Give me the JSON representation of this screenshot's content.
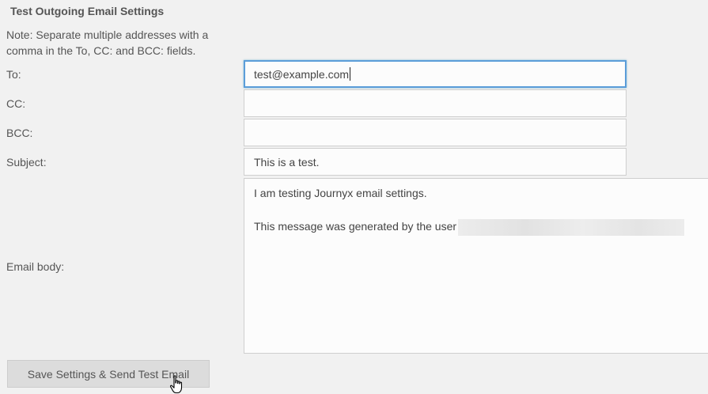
{
  "section": {
    "title": "Test Outgoing Email Settings",
    "note": "Note: Separate multiple addresses with a comma in the To, CC: and BCC: fields."
  },
  "fields": {
    "to": {
      "label": "To:",
      "value": "test@example.com"
    },
    "cc": {
      "label": "CC:",
      "value": ""
    },
    "bcc": {
      "label": "BCC:",
      "value": ""
    },
    "subject": {
      "label": "Subject:",
      "value": "This is a test."
    },
    "body": {
      "label": "Email body:",
      "line1": "I am testing Journyx email settings.",
      "line2": "This message was generated by the user"
    }
  },
  "actions": {
    "submit_label": "Save Settings & Send Test Email"
  },
  "icons": {
    "cursor": "hand-pointer-icon"
  },
  "colors": {
    "background": "#f1f1f1",
    "focus_border": "#5b9dd9",
    "button_bg": "#dcdcdc"
  }
}
